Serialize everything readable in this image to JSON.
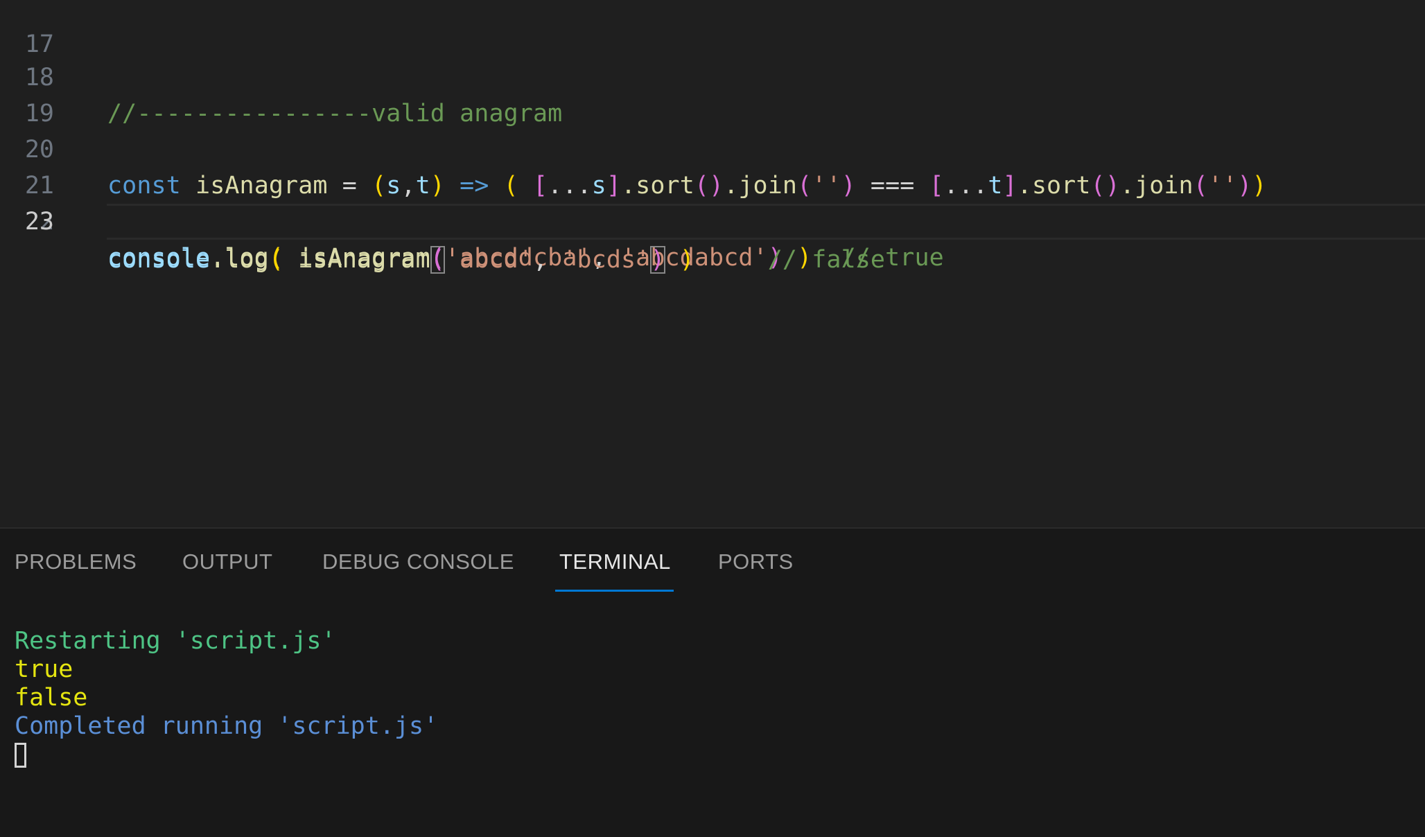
{
  "editor": {
    "lines": [
      {
        "no": "17"
      },
      {
        "no": "18"
      },
      {
        "no": "19"
      },
      {
        "no": "20"
      },
      {
        "no": "21"
      },
      {
        "no": "22"
      },
      {
        "no": "23"
      }
    ],
    "line18": {
      "comment": "//----------------valid anagram"
    },
    "line20": {
      "kw": "const",
      "name": "isAnagram",
      "eq": " = ",
      "p1": "(",
      "s": "s",
      "comma": ",",
      "t": "t",
      "p1c": ")",
      "arrow": " => ",
      "p2": "( ",
      "br1": "[",
      "spread1": "...",
      "s2": "s",
      "br1c": "]",
      "sort1": ".sort",
      "sp1": "(",
      "sp1c": ")",
      "join1": ".join",
      "jp1": "(",
      "str1": "''",
      "jp1c": ")",
      "strict": " === ",
      "br2": "[",
      "spread2": "...",
      "t2": "t",
      "br2c": "]",
      "sort2": ".sort",
      "sp2": "(",
      "sp2c": ")",
      "join2": ".join",
      "jp2": "(",
      "str2": "''",
      "jp2c": ")",
      "p2c": ")"
    },
    "line22": {
      "obj": "console",
      "log": ".log",
      "p1": "(",
      "fn": " isAnagram",
      "p2": "(",
      "a1": "'abcddcba'",
      "sep": ", ",
      "a2": "'abcdabcd'",
      "p2c": ")",
      "p1c": " )",
      "comment": "  // true"
    },
    "line23": {
      "obj": "console",
      "log": ".log",
      "p1": "(",
      "fn": " isAnagram",
      "p2": "(",
      "a1": "'abcd'",
      "sep": ", ",
      "a2": "'bcds'",
      "p2c": ")",
      "p1c": " )",
      "comment": "     // false"
    }
  },
  "panel": {
    "tabs": [
      "PROBLEMS",
      "OUTPUT",
      "DEBUG CONSOLE",
      "TERMINAL",
      "PORTS"
    ],
    "active_tab": "TERMINAL"
  },
  "terminal": {
    "lines": [
      "Restarting 'script.js'",
      "true",
      "false",
      "Completed running 'script.js'"
    ]
  },
  "colors": {
    "comment": "#6a9955",
    "keyword": "#569cd6",
    "function": "#dcdcaa",
    "string": "#ce9178",
    "active_tab_underline": "#0078d4"
  }
}
